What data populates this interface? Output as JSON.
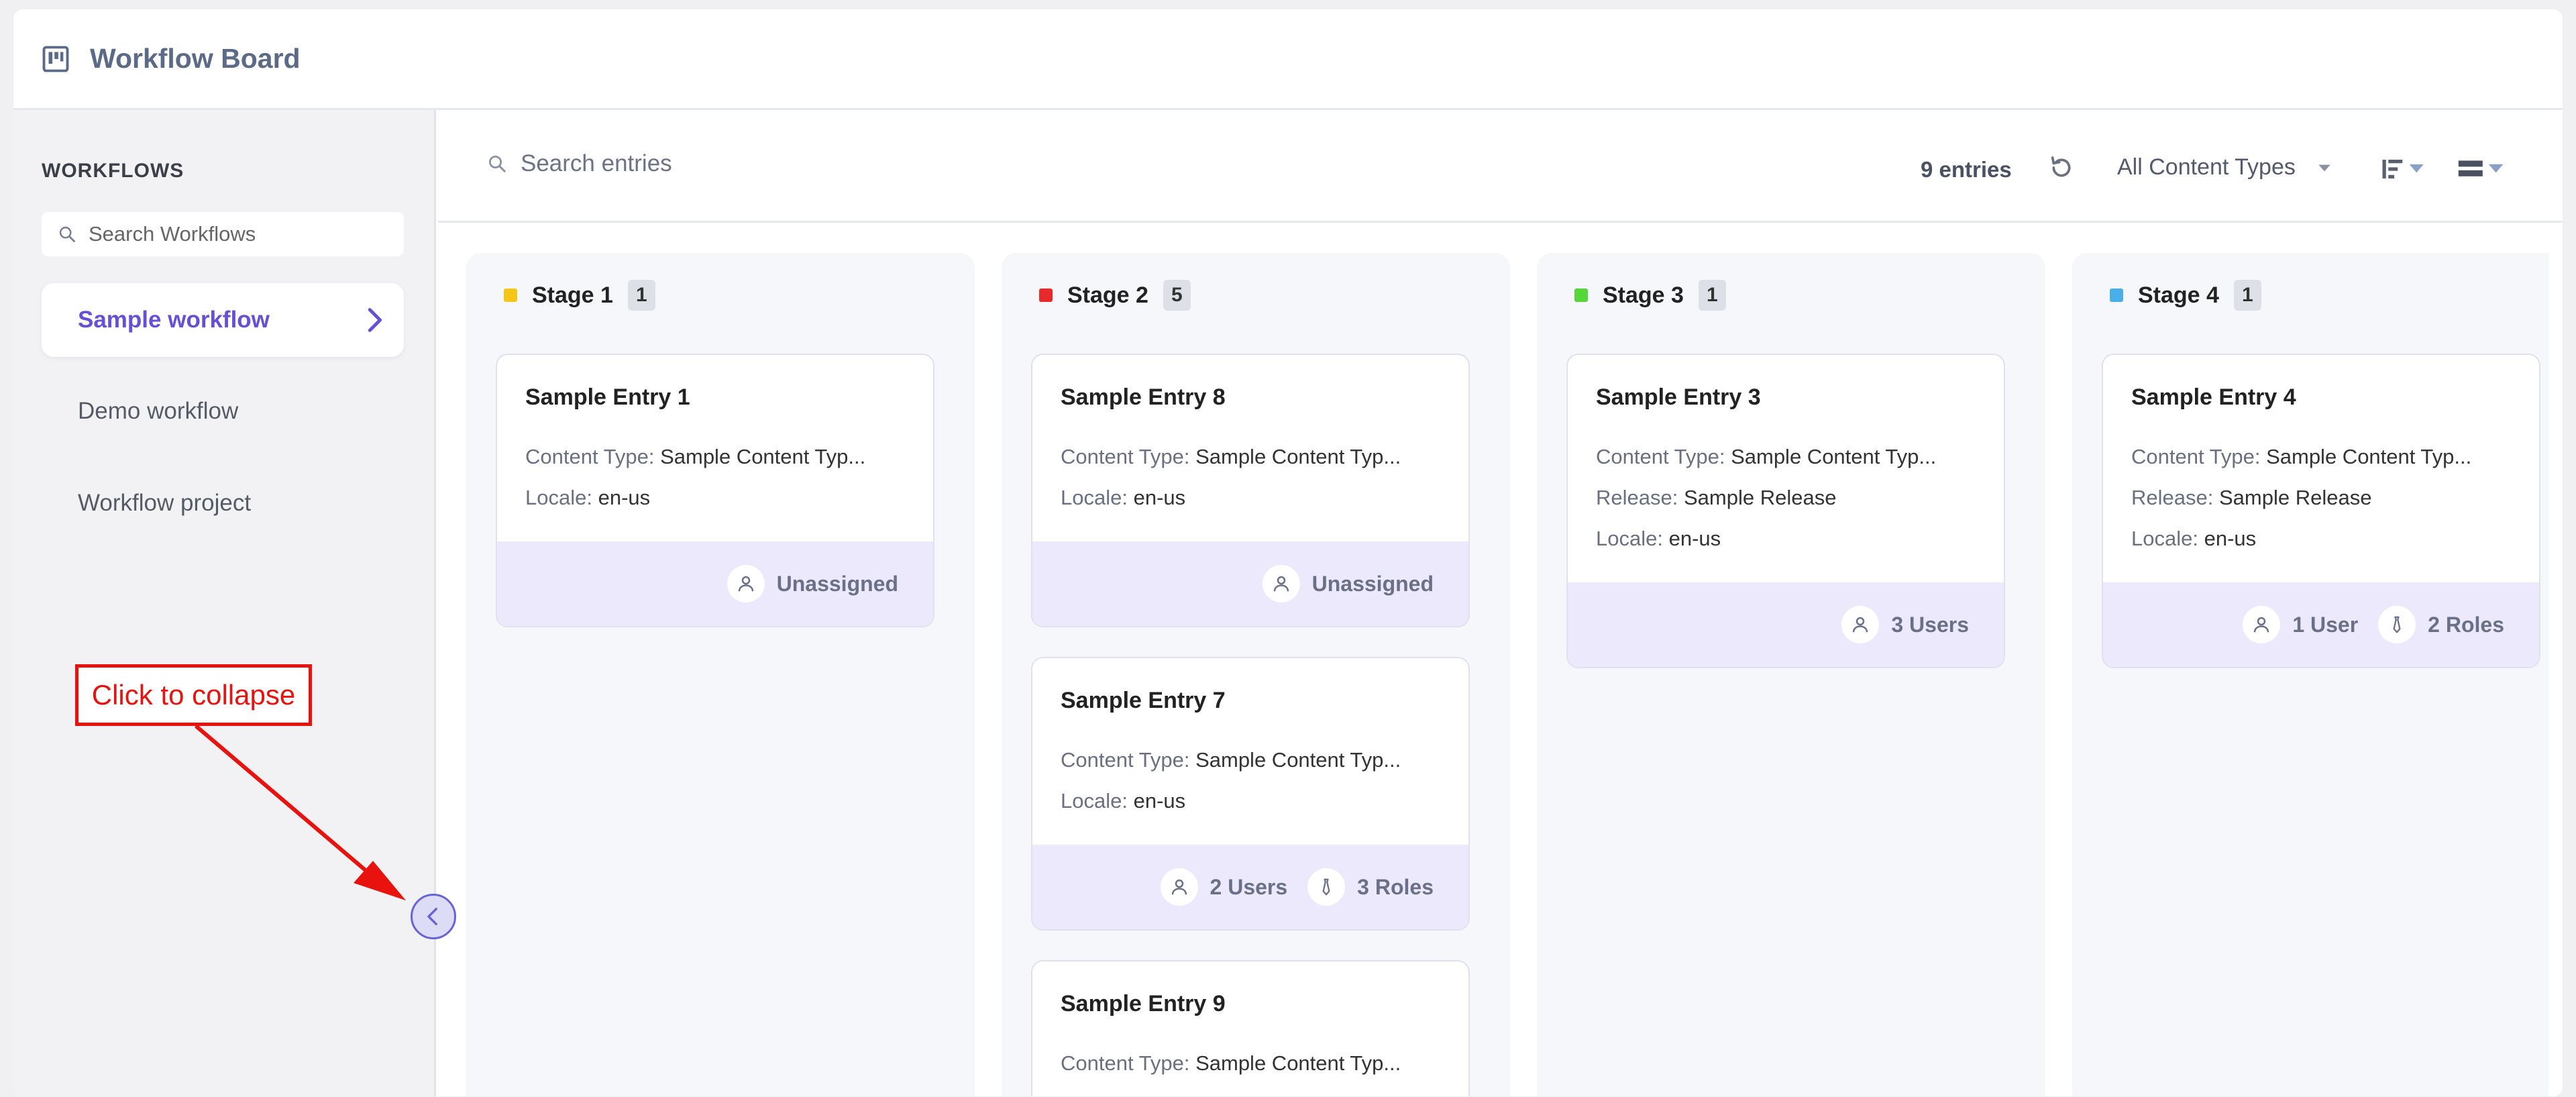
{
  "header": {
    "title": "Workflow Board",
    "icon": "board-icon"
  },
  "sidebar": {
    "heading": "WORKFLOWS",
    "search_placeholder": "Search Workflows",
    "items": [
      {
        "label": "Sample workflow",
        "active": true
      },
      {
        "label": "Demo workflow",
        "active": false
      },
      {
        "label": "Workflow project",
        "active": false
      }
    ]
  },
  "annotation": {
    "text": "Click to collapse",
    "color": "#e8130f"
  },
  "toolbar": {
    "search_placeholder": "Search entries",
    "entries_count": "9 entries",
    "content_type_filter": "All Content Types"
  },
  "stages": [
    {
      "name": "Stage 1",
      "count": "1",
      "color": "#f5c518",
      "cards": [
        {
          "title": "Sample Entry 1",
          "fields": [
            {
              "label": "Content Type:",
              "value": "Sample Content Typ..."
            },
            {
              "label": "Locale:",
              "value": "en-us"
            }
          ],
          "assignees": [
            {
              "icon": "user-icon",
              "text": "Unassigned"
            }
          ]
        }
      ]
    },
    {
      "name": "Stage 2",
      "count": "5",
      "color": "#e8292b",
      "cards": [
        {
          "title": "Sample Entry 8",
          "fields": [
            {
              "label": "Content Type:",
              "value": "Sample Content Typ..."
            },
            {
              "label": "Locale:",
              "value": "en-us"
            }
          ],
          "assignees": [
            {
              "icon": "user-icon",
              "text": "Unassigned"
            }
          ]
        },
        {
          "title": "Sample Entry 7",
          "fields": [
            {
              "label": "Content Type:",
              "value": "Sample Content Typ..."
            },
            {
              "label": "Locale:",
              "value": "en-us"
            }
          ],
          "assignees": [
            {
              "icon": "user-icon",
              "text": "2 Users"
            },
            {
              "icon": "tie-icon",
              "text": "3 Roles"
            }
          ]
        },
        {
          "title": "Sample Entry 9",
          "fields": [
            {
              "label": "Content Type:",
              "value": "Sample Content Typ..."
            }
          ],
          "assignees": []
        }
      ]
    },
    {
      "name": "Stage 3",
      "count": "1",
      "color": "#55d63a",
      "cards": [
        {
          "title": "Sample Entry 3",
          "fields": [
            {
              "label": "Content Type:",
              "value": "Sample Content Typ..."
            },
            {
              "label": "Release:",
              "value": "Sample Release"
            },
            {
              "label": "Locale:",
              "value": "en-us"
            }
          ],
          "assignees": [
            {
              "icon": "user-icon",
              "text": "3 Users"
            }
          ]
        }
      ]
    },
    {
      "name": "Stage 4",
      "count": "1",
      "color": "#4aaee8",
      "cards": [
        {
          "title": "Sample Entry 4",
          "fields": [
            {
              "label": "Content Type:",
              "value": "Sample Content Typ..."
            },
            {
              "label": "Release:",
              "value": "Sample Release"
            },
            {
              "label": "Locale:",
              "value": "en-us"
            }
          ],
          "assignees": [
            {
              "icon": "user-icon",
              "text": "1 User"
            },
            {
              "icon": "tie-icon",
              "text": "2 Roles"
            }
          ]
        }
      ]
    }
  ]
}
